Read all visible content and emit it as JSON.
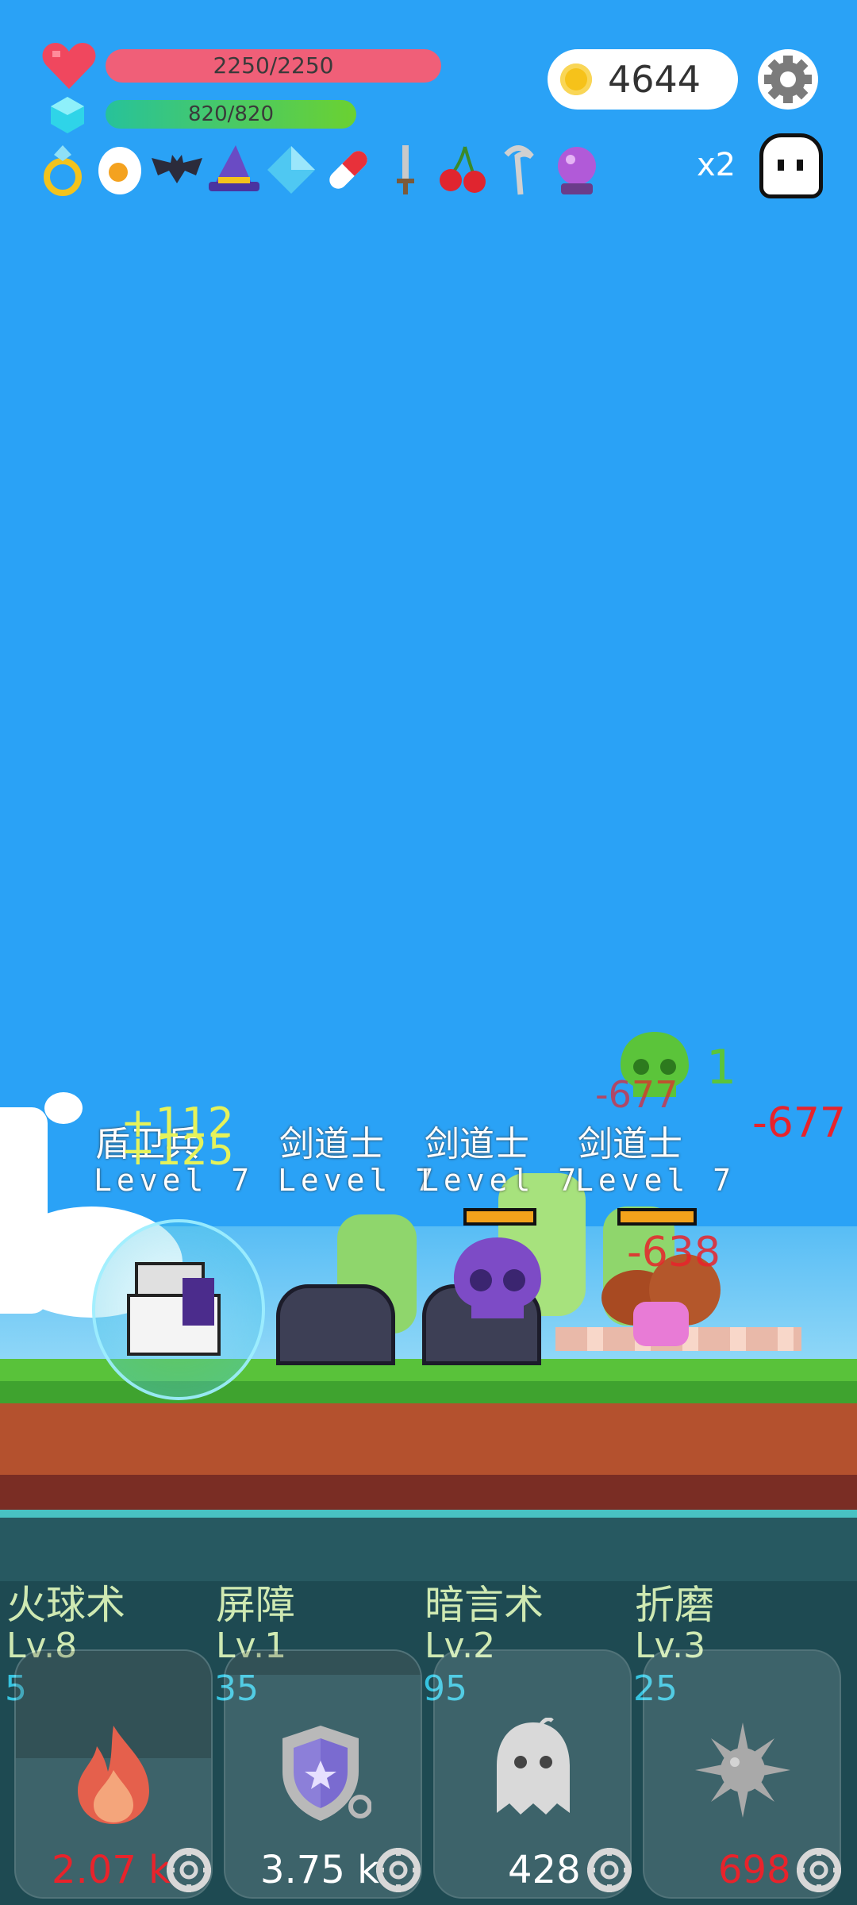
{
  "hud": {
    "hp_text": "2250/2250",
    "hp_fraction": 1.0,
    "mp_text": "820/820",
    "mp_fraction": 1.0,
    "coins": "4644",
    "speed_multiplier": "x2",
    "items": [
      "ring-icon",
      "egg-icon",
      "bat-icon",
      "wizard-hat-icon",
      "diamond-icon",
      "pill-icon",
      "sword-icon",
      "cherry-icon",
      "scythe-icon",
      "crystal-ball-icon"
    ]
  },
  "battle": {
    "enemies": [
      {
        "name": "盾卫兵",
        "level": "Level 7"
      },
      {
        "name": "剑道士",
        "level": "Level 7"
      },
      {
        "name": "剑道士",
        "level": "Level 7"
      },
      {
        "name": "剑道士",
        "level": "Level 7"
      }
    ],
    "floating_numbers": {
      "heal1": "+112",
      "heal2": "+125",
      "dmg1": "-677",
      "dmg2": "-677",
      "dmg3": "-638",
      "green_one": "1"
    }
  },
  "skills": [
    {
      "name": "火球术",
      "level": "Lv.8",
      "cost": "5",
      "damage": "2.07 k",
      "icon": "fire-icon"
    },
    {
      "name": "屏障",
      "level": "Lv.1",
      "cost": "35",
      "damage": "3.75 k",
      "icon": "shield-icon"
    },
    {
      "name": "暗言术",
      "level": "Lv.2",
      "cost": "95",
      "damage": "428",
      "icon": "ghost-icon"
    },
    {
      "name": "折磨",
      "level": "Lv.3",
      "cost": "25",
      "damage": "698",
      "icon": "spiked-ball-icon"
    }
  ],
  "colors": {
    "sky": "#2aa2f6",
    "hp": "#f05f78",
    "mp": "#6bd131",
    "damage_red": "#e8232b",
    "heal_yellow": "#e5f25a",
    "skill_name": "#cfe9b2",
    "cost_cyan": "#36c4e0"
  }
}
